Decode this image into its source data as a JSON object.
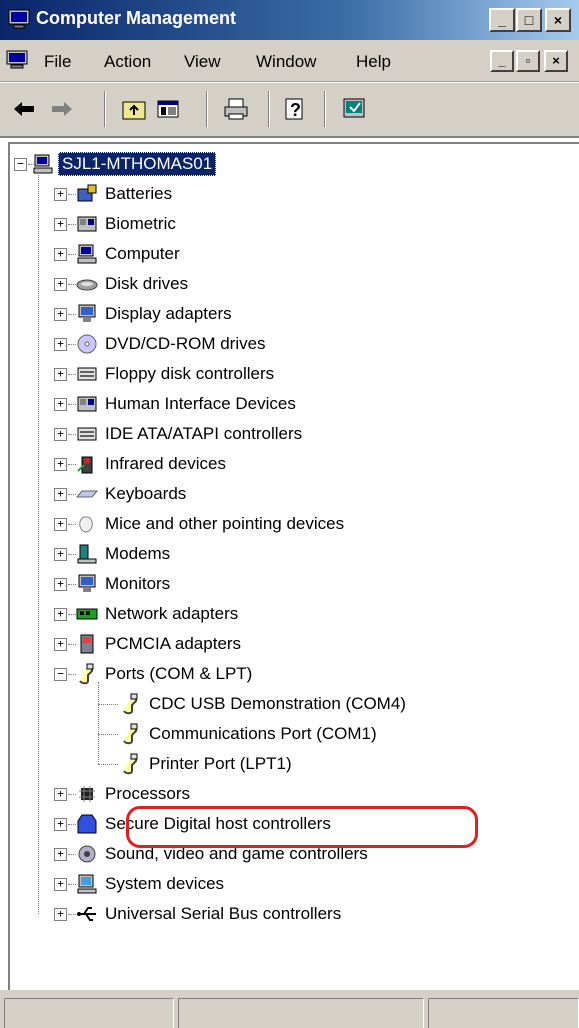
{
  "window": {
    "title": "Computer Management"
  },
  "menubar": {
    "items": [
      "File",
      "Action",
      "View",
      "Window",
      "Help"
    ]
  },
  "toolbar": {
    "buttons": [
      "back-icon",
      "forward-icon",
      "up-folder-icon",
      "show-hide-tree-icon",
      "print-icon",
      "help-icon",
      "properties-icon"
    ]
  },
  "tree": {
    "root": "SJL1-MTHOMAS01",
    "categories": [
      "Batteries",
      "Biometric",
      "Computer",
      "Disk drives",
      "Display adapters",
      "DVD/CD-ROM drives",
      "Floppy disk controllers",
      "Human Interface Devices",
      "IDE ATA/ATAPI controllers",
      "Infrared devices",
      "Keyboards",
      "Mice and other pointing devices",
      "Modems",
      "Monitors",
      "Network adapters",
      "PCMCIA adapters"
    ],
    "ports": {
      "label": "Ports (COM & LPT)",
      "children": [
        "CDC USB Demonstration (COM4)",
        "Communications Port (COM1)",
        "Printer Port (LPT1)"
      ]
    },
    "categories_after": [
      "Processors",
      "Secure Digital host controllers",
      "Sound, video and game controllers",
      "System devices",
      "Universal Serial Bus controllers"
    ]
  },
  "colors": {
    "title_bg": "#0a246a",
    "selection": "#0a246a",
    "highlight_outline": "#e02020",
    "chrome": "#d4d0c8"
  }
}
